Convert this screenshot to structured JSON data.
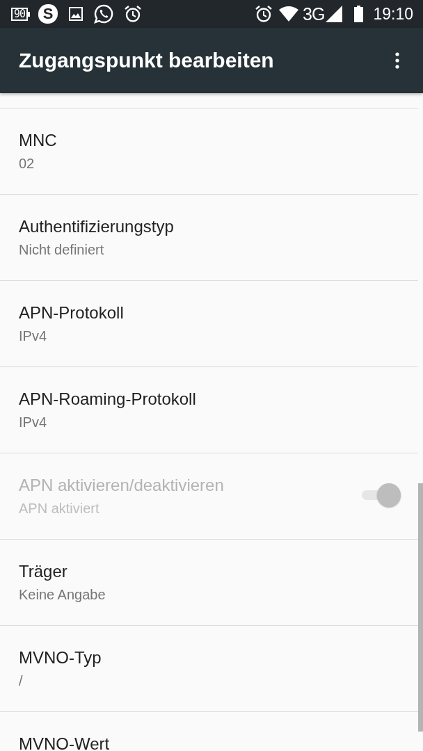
{
  "status_bar": {
    "battery_saver_label": "90",
    "app_logo_letter": "S",
    "network_type": "3G",
    "time": "19:10"
  },
  "app_bar": {
    "title": "Zugangspunkt bearbeiten"
  },
  "settings": [
    {
      "kind": "text",
      "title": "MNC",
      "summary": "02",
      "disabled": false
    },
    {
      "kind": "text",
      "title": "Authentifizierungstyp",
      "summary": "Nicht definiert",
      "disabled": false
    },
    {
      "kind": "text",
      "title": "APN-Protokoll",
      "summary": "IPv4",
      "disabled": false
    },
    {
      "kind": "text",
      "title": "APN-Roaming-Protokoll",
      "summary": "IPv4",
      "disabled": false
    },
    {
      "kind": "switch",
      "title": "APN aktivieren/deaktivieren",
      "summary": "APN aktiviert",
      "disabled": true,
      "on": true
    },
    {
      "kind": "text",
      "title": "Träger",
      "summary": "Keine Angabe",
      "disabled": false
    },
    {
      "kind": "text",
      "title": "MVNO-Typ",
      "summary": "/",
      "disabled": false
    },
    {
      "kind": "text",
      "title": "MVNO-Wert",
      "disabled": false
    }
  ]
}
